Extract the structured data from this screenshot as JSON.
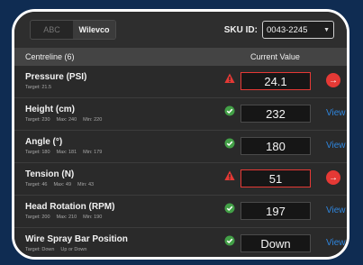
{
  "header": {
    "segments": [
      "ABC",
      "Wilevco"
    ],
    "active_segment": "Wilevco",
    "sku_label": "SKU ID:",
    "sku_value": "0043-2245"
  },
  "table": {
    "col_name": "Centreline (6)",
    "col_value": "Current Value",
    "rows": [
      {
        "name": "Pressure (PSI)",
        "meta": [
          "Target: 21.5"
        ],
        "value": "24.1",
        "status": "warning",
        "action": "go"
      },
      {
        "name": "Height (cm)",
        "meta": [
          "Target: 230",
          "Max: 240",
          "Min: 220"
        ],
        "value": "232",
        "status": "ok",
        "action": "View"
      },
      {
        "name": "Angle (°)",
        "meta": [
          "Target: 180",
          "Max: 181",
          "Min: 179"
        ],
        "value": "180",
        "status": "ok",
        "action": "View"
      },
      {
        "name": "Tension (N)",
        "meta": [
          "Target: 46",
          "Max: 49",
          "Min: 43"
        ],
        "value": "51",
        "status": "warning",
        "action": "go"
      },
      {
        "name": "Head Rotation (RPM)",
        "meta": [
          "Target: 200",
          "Max: 210",
          "Min: 190"
        ],
        "value": "197",
        "status": "ok",
        "action": "View"
      },
      {
        "name": "Wire Spray Bar Position",
        "meta": [
          "Target: Down",
          "Up or Down"
        ],
        "value": "Down",
        "status": "ok",
        "action": "View"
      }
    ]
  },
  "colors": {
    "warning": "#e53935",
    "ok": "#43a047",
    "link": "#2e86de"
  }
}
